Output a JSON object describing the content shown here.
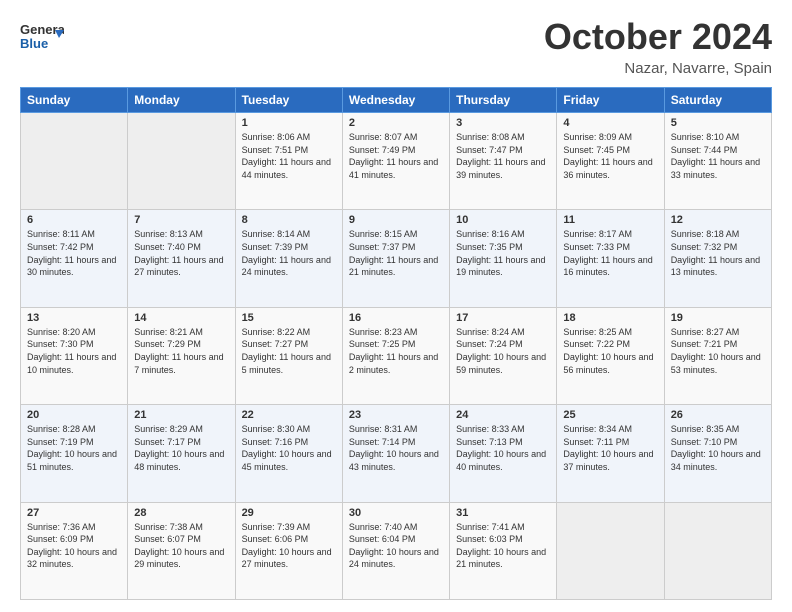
{
  "header": {
    "logo_line1": "General",
    "logo_line2": "Blue",
    "month": "October 2024",
    "location": "Nazar, Navarre, Spain"
  },
  "weekdays": [
    "Sunday",
    "Monday",
    "Tuesday",
    "Wednesday",
    "Thursday",
    "Friday",
    "Saturday"
  ],
  "weeks": [
    [
      {
        "day": "",
        "info": ""
      },
      {
        "day": "",
        "info": ""
      },
      {
        "day": "1",
        "info": "Sunrise: 8:06 AM\nSunset: 7:51 PM\nDaylight: 11 hours and 44 minutes."
      },
      {
        "day": "2",
        "info": "Sunrise: 8:07 AM\nSunset: 7:49 PM\nDaylight: 11 hours and 41 minutes."
      },
      {
        "day": "3",
        "info": "Sunrise: 8:08 AM\nSunset: 7:47 PM\nDaylight: 11 hours and 39 minutes."
      },
      {
        "day": "4",
        "info": "Sunrise: 8:09 AM\nSunset: 7:45 PM\nDaylight: 11 hours and 36 minutes."
      },
      {
        "day": "5",
        "info": "Sunrise: 8:10 AM\nSunset: 7:44 PM\nDaylight: 11 hours and 33 minutes."
      }
    ],
    [
      {
        "day": "6",
        "info": "Sunrise: 8:11 AM\nSunset: 7:42 PM\nDaylight: 11 hours and 30 minutes."
      },
      {
        "day": "7",
        "info": "Sunrise: 8:13 AM\nSunset: 7:40 PM\nDaylight: 11 hours and 27 minutes."
      },
      {
        "day": "8",
        "info": "Sunrise: 8:14 AM\nSunset: 7:39 PM\nDaylight: 11 hours and 24 minutes."
      },
      {
        "day": "9",
        "info": "Sunrise: 8:15 AM\nSunset: 7:37 PM\nDaylight: 11 hours and 21 minutes."
      },
      {
        "day": "10",
        "info": "Sunrise: 8:16 AM\nSunset: 7:35 PM\nDaylight: 11 hours and 19 minutes."
      },
      {
        "day": "11",
        "info": "Sunrise: 8:17 AM\nSunset: 7:33 PM\nDaylight: 11 hours and 16 minutes."
      },
      {
        "day": "12",
        "info": "Sunrise: 8:18 AM\nSunset: 7:32 PM\nDaylight: 11 hours and 13 minutes."
      }
    ],
    [
      {
        "day": "13",
        "info": "Sunrise: 8:20 AM\nSunset: 7:30 PM\nDaylight: 11 hours and 10 minutes."
      },
      {
        "day": "14",
        "info": "Sunrise: 8:21 AM\nSunset: 7:29 PM\nDaylight: 11 hours and 7 minutes."
      },
      {
        "day": "15",
        "info": "Sunrise: 8:22 AM\nSunset: 7:27 PM\nDaylight: 11 hours and 5 minutes."
      },
      {
        "day": "16",
        "info": "Sunrise: 8:23 AM\nSunset: 7:25 PM\nDaylight: 11 hours and 2 minutes."
      },
      {
        "day": "17",
        "info": "Sunrise: 8:24 AM\nSunset: 7:24 PM\nDaylight: 10 hours and 59 minutes."
      },
      {
        "day": "18",
        "info": "Sunrise: 8:25 AM\nSunset: 7:22 PM\nDaylight: 10 hours and 56 minutes."
      },
      {
        "day": "19",
        "info": "Sunrise: 8:27 AM\nSunset: 7:21 PM\nDaylight: 10 hours and 53 minutes."
      }
    ],
    [
      {
        "day": "20",
        "info": "Sunrise: 8:28 AM\nSunset: 7:19 PM\nDaylight: 10 hours and 51 minutes."
      },
      {
        "day": "21",
        "info": "Sunrise: 8:29 AM\nSunset: 7:17 PM\nDaylight: 10 hours and 48 minutes."
      },
      {
        "day": "22",
        "info": "Sunrise: 8:30 AM\nSunset: 7:16 PM\nDaylight: 10 hours and 45 minutes."
      },
      {
        "day": "23",
        "info": "Sunrise: 8:31 AM\nSunset: 7:14 PM\nDaylight: 10 hours and 43 minutes."
      },
      {
        "day": "24",
        "info": "Sunrise: 8:33 AM\nSunset: 7:13 PM\nDaylight: 10 hours and 40 minutes."
      },
      {
        "day": "25",
        "info": "Sunrise: 8:34 AM\nSunset: 7:11 PM\nDaylight: 10 hours and 37 minutes."
      },
      {
        "day": "26",
        "info": "Sunrise: 8:35 AM\nSunset: 7:10 PM\nDaylight: 10 hours and 34 minutes."
      }
    ],
    [
      {
        "day": "27",
        "info": "Sunrise: 7:36 AM\nSunset: 6:09 PM\nDaylight: 10 hours and 32 minutes."
      },
      {
        "day": "28",
        "info": "Sunrise: 7:38 AM\nSunset: 6:07 PM\nDaylight: 10 hours and 29 minutes."
      },
      {
        "day": "29",
        "info": "Sunrise: 7:39 AM\nSunset: 6:06 PM\nDaylight: 10 hours and 27 minutes."
      },
      {
        "day": "30",
        "info": "Sunrise: 7:40 AM\nSunset: 6:04 PM\nDaylight: 10 hours and 24 minutes."
      },
      {
        "day": "31",
        "info": "Sunrise: 7:41 AM\nSunset: 6:03 PM\nDaylight: 10 hours and 21 minutes."
      },
      {
        "day": "",
        "info": ""
      },
      {
        "day": "",
        "info": ""
      }
    ]
  ]
}
